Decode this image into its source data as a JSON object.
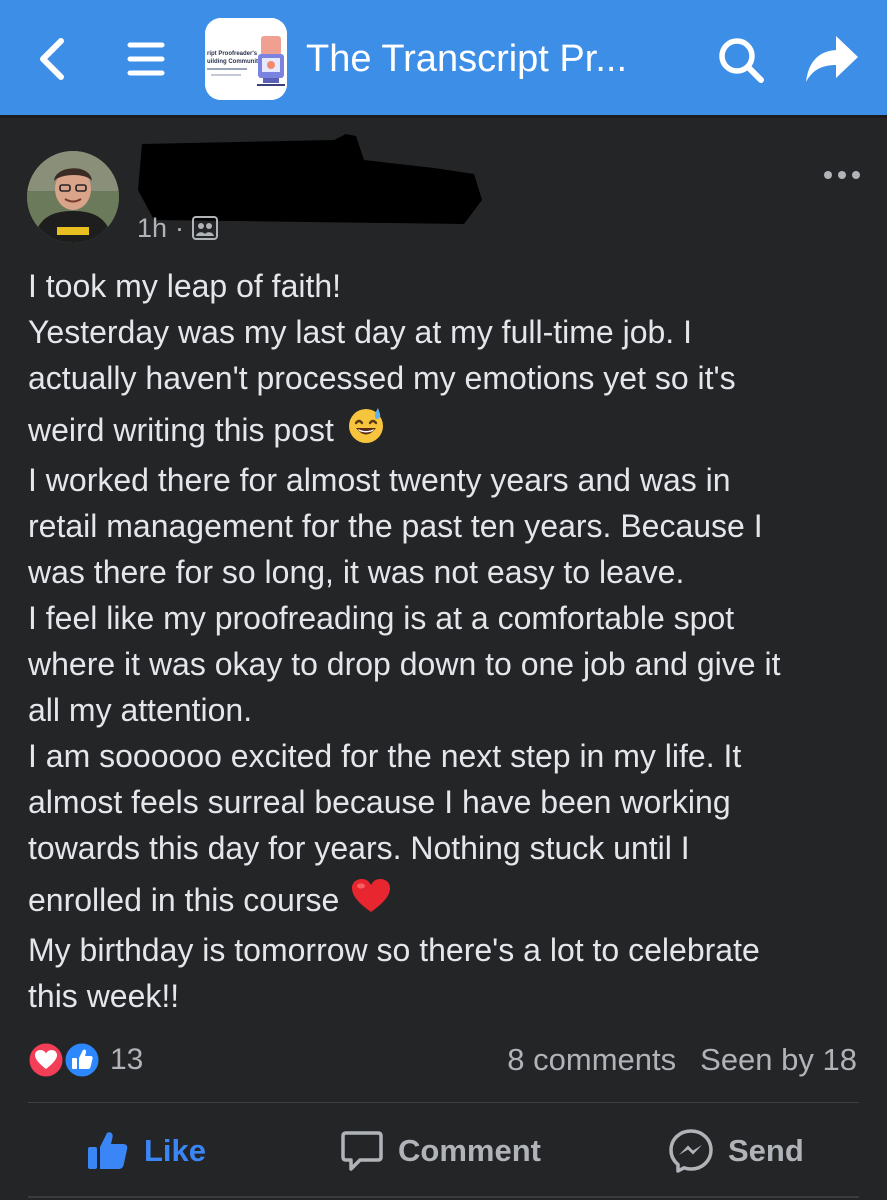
{
  "topbar": {
    "title": "The Transcript Pr...",
    "thumb_text": [
      "ript Proofreader's",
      "uilding Community"
    ],
    "background": "#3d8ee6"
  },
  "post": {
    "time": "1h",
    "separator": "·",
    "audience_icon": "group-audience-icon",
    "body_lines": [
      "I took my leap of faith!",
      "Yesterday was my last day at my full-time job. I",
      "actually haven't processed my emotions yet so it's",
      "weird writing this post",
      "I worked there for almost twenty years and was in",
      "retail management for the past ten years. Because I",
      "was there for so long, it was not easy to leave.",
      "I feel like my proofreading is at a comfortable spot",
      "where it was okay to drop down to one job and give it",
      "all my attention.",
      "I am soooooo excited for the next step in my life. It",
      "almost feels surreal because I have been working",
      "towards this day for years. Nothing stuck until I",
      "enrolled in this course",
      "My birthday is tomorrow so there's a lot to celebrate",
      "this week!!"
    ],
    "emojis": {
      "sweat_smile": "sweat-smile-emoji",
      "heart": "red-heart-emoji"
    }
  },
  "reactions": {
    "count": "13",
    "comments": "8 comments",
    "seen_by": "Seen by 18",
    "like_color": "#3b86f7",
    "love_color": "#f33e58"
  },
  "actions": {
    "like": "Like",
    "comment": "Comment",
    "send": "Send"
  }
}
